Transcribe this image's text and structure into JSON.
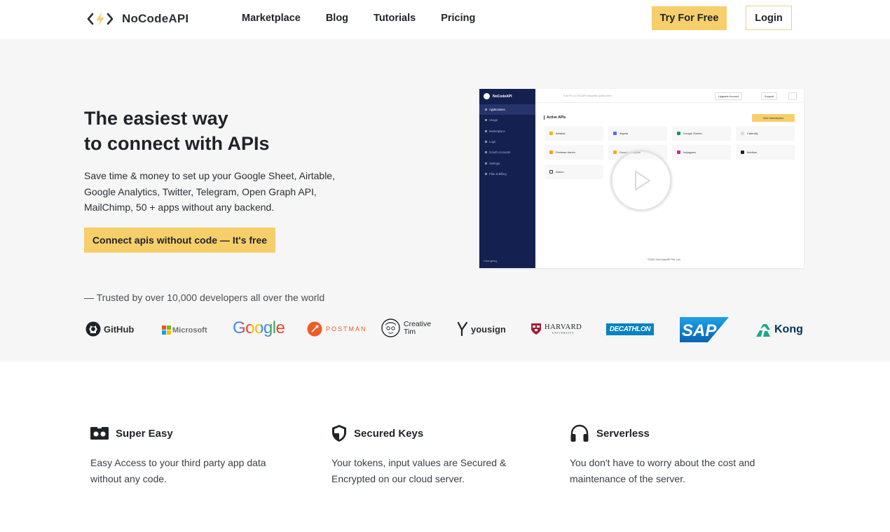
{
  "nav": {
    "brand": "NoCodeAPI",
    "links": [
      "Marketplace",
      "Blog",
      "Tutorials",
      "Pricing"
    ],
    "try_label": "Try For Free",
    "login_label": "Login"
  },
  "hero": {
    "title_line1": "The easiest way",
    "title_line2": "to connect with APIs",
    "description": "Save time & money to set up your Google Sheet, Airtable, Google Analytics, Twitter, Telegram, Open Graph API, MailChimp, 50 + apps without any backend.",
    "cta_label": "Connect apis without code — It's free",
    "trusted": "— Trusted by over 10,000 developers all over the world"
  },
  "preview": {
    "brand": "NoCodeAPI",
    "menu": [
      "Applications",
      "Usage",
      "Marketplace",
      "Logs",
      "OAuth Accounts",
      "Settings",
      "Plan & Billing"
    ],
    "changelog": "Changelog",
    "quota": "0.447% (4,700) API requests quota used",
    "upgrade": "Upgrade Account",
    "support": "Support",
    "active_apis": "Active APIs",
    "view_marketplace": "View Marketplace",
    "apps": [
      "Airtable",
      "Algolia",
      "Google Sheets",
      "Calendly",
      "Firebase Admin",
      "Google Analytics",
      "Instagram",
      "Medium",
      "Notion"
    ],
    "footer": "©2021 NoCodeAPI Pte. Ltd."
  },
  "logos": {
    "github": "GitHub",
    "microsoft": "Microsoft",
    "google": "Google",
    "postman": "POSTMAN",
    "creative_tim": "Creative Tim",
    "creative": "Creative",
    "tim": "Tim",
    "yousign": "yousign",
    "harvard": "HARVARD",
    "harvard_sub": "UNIVERSITY",
    "decathlon": "DECATHLON",
    "sap": "SAP",
    "kong": "Kong"
  },
  "features": [
    {
      "title": "Super Easy",
      "description": "Easy Access to your third party app data without any code.",
      "icon": "vr-headset-icon"
    },
    {
      "title": "Secured Keys",
      "description": "Your tokens, input values are Secured & Encrypted on our cloud server.",
      "icon": "shield-icon"
    },
    {
      "title": "Serverless",
      "description": "You don't have to worry about the cost and maintenance of the server.",
      "icon": "headphones-icon"
    }
  ],
  "colors": {
    "accent": "#f6cf6b",
    "sidebar": "#14204f",
    "hero_bg": "#f6f6f6"
  }
}
